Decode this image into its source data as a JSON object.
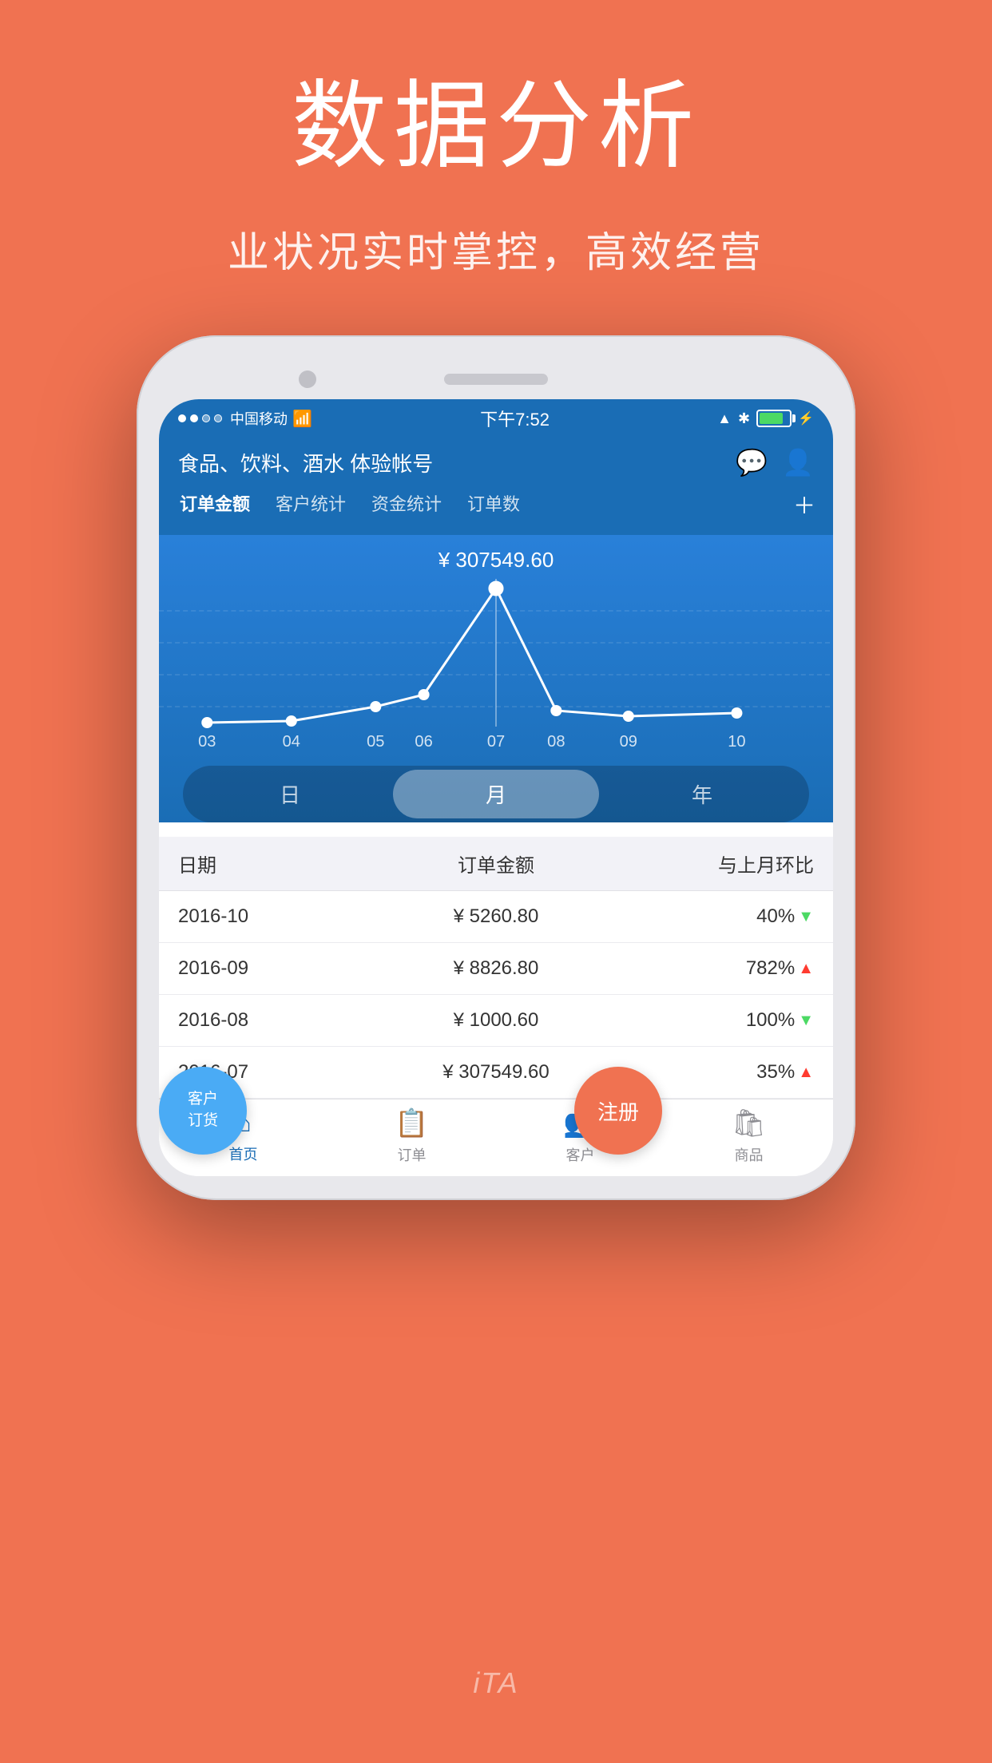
{
  "header": {
    "title": "数据分析",
    "subtitle": "业状况实时掌控，高效经营"
  },
  "status_bar": {
    "carrier": "中国移动",
    "wifi": "WiFi",
    "time": "下午7:52",
    "battery_level": "80"
  },
  "app_header": {
    "title": "食品、饮料、酒水 体验帐号",
    "chat_icon": "💬",
    "user_icon": "👤"
  },
  "tabs": [
    {
      "label": "订单金额",
      "active": true
    },
    {
      "label": "客户统计",
      "active": false
    },
    {
      "label": "资金统计",
      "active": false
    },
    {
      "label": "订单数",
      "active": false
    }
  ],
  "chart": {
    "value_label": "¥ 307549.60",
    "x_labels": [
      "03",
      "04",
      "05",
      "06",
      "07",
      "08",
      "09",
      "10"
    ],
    "data_points": [
      0,
      0,
      5,
      10,
      95,
      8,
      4,
      5
    ]
  },
  "time_selector": {
    "options": [
      {
        "label": "日",
        "active": false
      },
      {
        "label": "月",
        "active": true
      },
      {
        "label": "年",
        "active": false
      }
    ]
  },
  "table": {
    "headers": {
      "date": "日期",
      "amount": "订单金额",
      "change": "与上月环比"
    },
    "rows": [
      {
        "date": "2016-10",
        "amount": "¥ 5260.80",
        "change": "40%",
        "direction": "down"
      },
      {
        "date": "2016-09",
        "amount": "¥ 8826.80",
        "change": "782%",
        "direction": "up"
      },
      {
        "date": "2016-08",
        "amount": "¥ 1000.60",
        "change": "100%",
        "direction": "down"
      },
      {
        "date": "2016-07",
        "amount": "¥ 307549.60",
        "change": "35%",
        "direction": "up"
      }
    ]
  },
  "bottom_nav": [
    {
      "label": "首页",
      "active": true,
      "icon": "🏠"
    },
    {
      "label": "订单",
      "active": false,
      "icon": "📋"
    },
    {
      "label": "客户",
      "active": false,
      "icon": "👥"
    },
    {
      "label": "商品",
      "active": false,
      "icon": "🛍"
    }
  ],
  "float_buttons": {
    "customer": "客户\n订货",
    "register": "注册"
  },
  "watermark": "iTA"
}
